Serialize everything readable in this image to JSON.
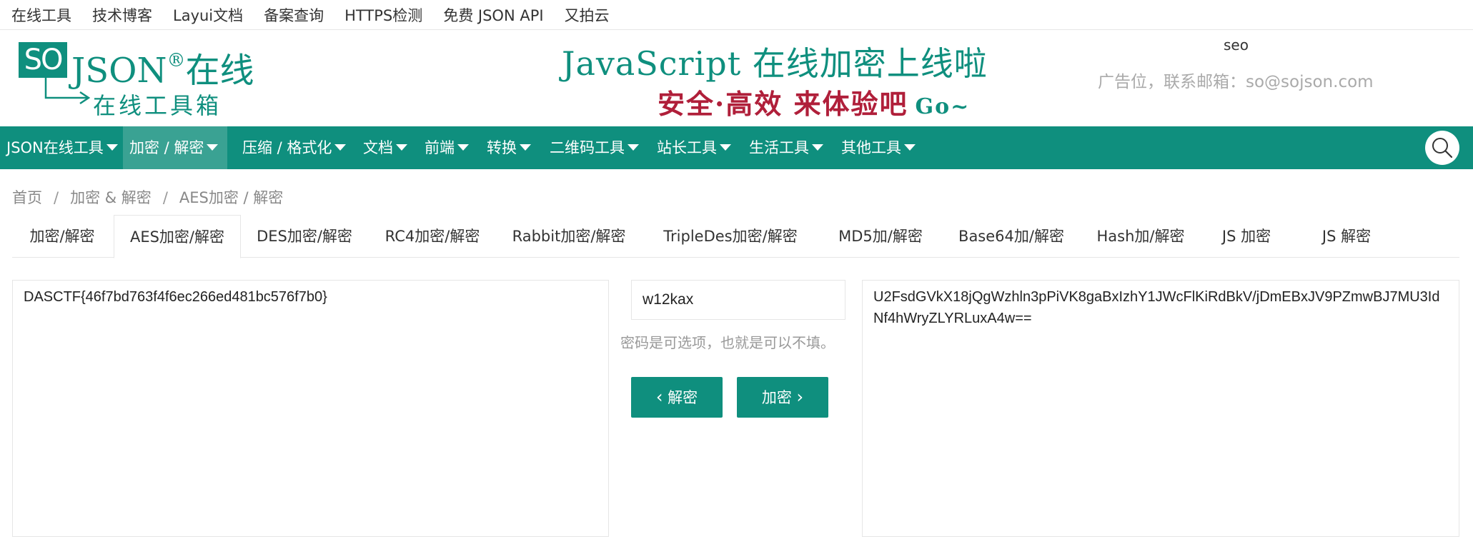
{
  "topbar": {
    "links": [
      "在线工具",
      "技术博客",
      "Layui文档",
      "备案查询",
      "HTTPS检测",
      "免费 JSON API",
      "又拍云"
    ]
  },
  "header": {
    "logo_so": "SO",
    "logo_json": "JSON",
    "logo_reg": "®",
    "logo_zaixian": "在线",
    "logo_sub": "在线工具箱",
    "banner_line1": "JavaScript 在线加密上线啦",
    "banner_line2": "安全·高效 来体验吧",
    "banner_go": "Go~",
    "seo": "seo",
    "ad": "广告位，联系邮箱：so@sojson.com"
  },
  "nav": {
    "items": [
      "JSON在线工具",
      "加密 / 解密",
      "压缩 / 格式化",
      "文档",
      "前端",
      "转换",
      "二维码工具",
      "站长工具",
      "生活工具",
      "其他工具"
    ],
    "active_index": 1
  },
  "breadcrumb": [
    "首页",
    "加密 & 解密",
    "AES加密 / 解密"
  ],
  "tabs": {
    "items": [
      "加密/解密",
      "AES加密/解密",
      "DES加密/解密",
      "RC4加密/解密",
      "Rabbit加密/解密",
      "TripleDes加密/解密",
      "MD5加/解密",
      "Base64加/解密",
      "Hash加/解密",
      "JS 加密",
      "JS 解密"
    ],
    "active_index": 1
  },
  "main": {
    "plaintext": "DASCTF{46f7bd763f4f6ec266ed481bc576f7b0}",
    "password": "w12kax",
    "password_hint": "密码是可选项，也就是可以不填。",
    "decrypt_label": "解密",
    "encrypt_label": "加密",
    "ciphertext": "U2FsdGVkX18jQgWzhln3pPiVK8gaBxIzhY1JWcFlKiRdBkV/jDmEBxJV9PZmwBJ7MU3IdNf4hWryZLYRLuxA4w=="
  },
  "colors": {
    "brand": "#0f8f7e",
    "nav_active": "#3aa293",
    "banner_red": "#b01f3a"
  }
}
